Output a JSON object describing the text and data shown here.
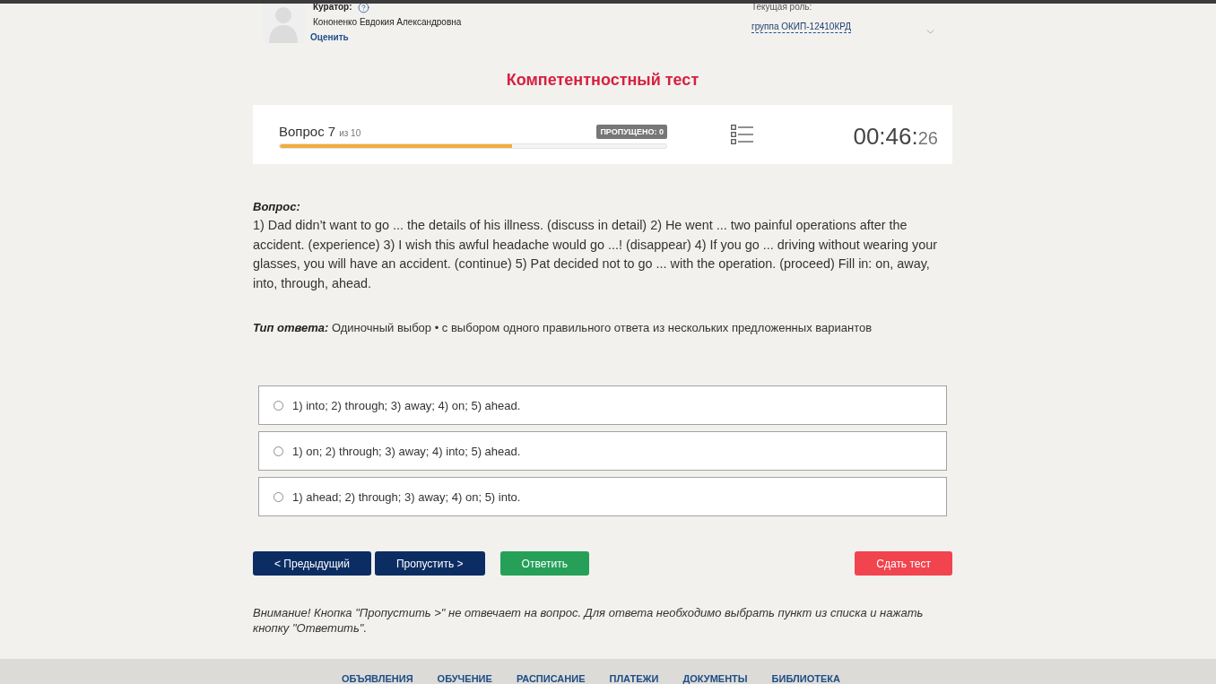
{
  "header": {
    "curator": {
      "label": "Куратор:",
      "name": "Кононенко Евдокия Александровна",
      "rate_link": "Оценить"
    },
    "role": {
      "label": "Текущая роль:",
      "value": "группа ОКИП-12410КРД"
    }
  },
  "title": "Компетентностный тест",
  "progress": {
    "question": "Вопрос 7",
    "total": "из 10",
    "skipped_badge": "ПРОПУЩЕНО: 0",
    "level": 0.6,
    "timer": {
      "main": "00:46:",
      "seconds": "26"
    }
  },
  "question": {
    "label": "Вопрос:",
    "text": "1) Dad didn’t want to go ... the details of his illness. (discuss in detail) 2) He went ... two painful operations after the accident. (experience) 3) I wish this awful headache would go ...! (disappear) 4) If you go ... driving without wearing your glasses, you will have an accident. (continue) 5) Pat decided not to go ... with the operation. (proceed) Fill in: on, away, into, through, ahead."
  },
  "answer_type": "**Тип ответа:** Одиночный выбор • с выбором одного правильного ответа из нескольких предложенных вариантов",
  "options": [
    {
      "text": "1) into; 2) through; 3) away; 4) on; 5) ahead.",
      "selected": false
    },
    {
      "text": "1) on; 2) through; 3) away; 4) into; 5) ahead.",
      "selected": false
    },
    {
      "text": "1) ahead; 2) through; 3) away; 4) on; 5) into.",
      "selected": false
    }
  ],
  "buttons": [
    {
      "label": "< Предыдущий",
      "kind": "nav"
    },
    {
      "label": "Пропустить >",
      "kind": "nav"
    },
    {
      "label": "Ответить",
      "kind": "answer"
    },
    {
      "label": "Сдать тест",
      "kind": "finish"
    }
  ],
  "notice": "Внимание! Кнопка \"Пропустить >\" не отвечает на вопрос. Для ответа необходимо выбрать пункт из списка и нажать кнопку \"Ответить\".",
  "footer_nav": [
    "ОБЪЯВЛЕНИЯ",
    "ОБУЧЕНИЕ",
    "РАСПИСАНИЕ",
    "ПЛАТЕЖИ",
    "ДОКУМЕНТЫ",
    "БИБЛИОТЕКА"
  ]
}
